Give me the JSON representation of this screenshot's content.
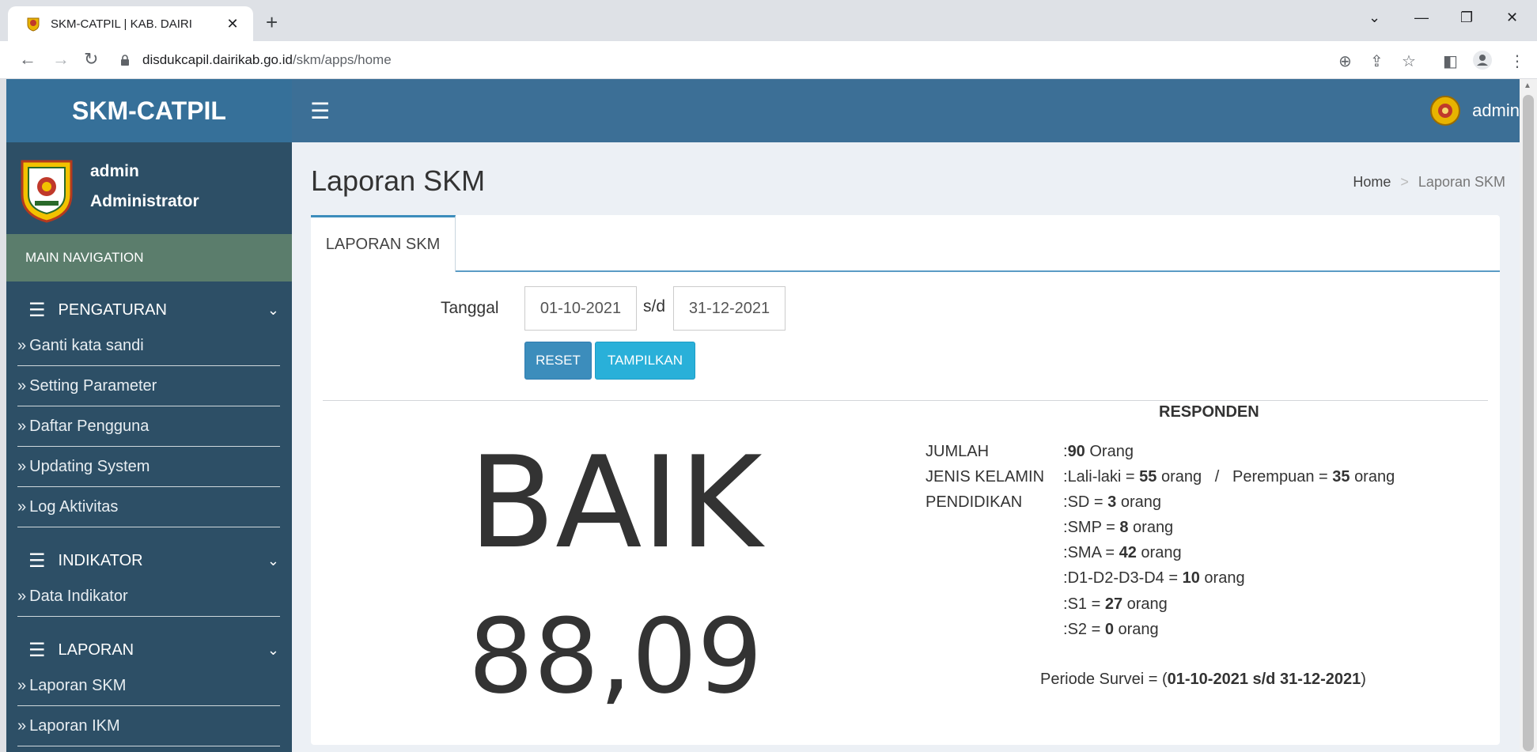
{
  "browser": {
    "tab_title": "SKM-CATPIL | KAB. DAIRI",
    "tab_close": "✕",
    "new_tab": "+",
    "url_host": "disdukcapil.dairikab.go.id",
    "url_path": "/skm/apps/home"
  },
  "header": {
    "brand": "SKM-CATPIL",
    "menu_icon": "☰",
    "user": "admin"
  },
  "sidebar": {
    "user_name": "admin",
    "user_role": "Administrator",
    "main_nav": "MAIN NAVIGATION",
    "sections": [
      {
        "title": "PENGATURAN",
        "items": [
          "Ganti kata sandi",
          "Setting Parameter",
          "Daftar Pengguna",
          "Updating System",
          "Log Aktivitas"
        ]
      },
      {
        "title": "INDIKATOR",
        "items": [
          "Data Indikator"
        ]
      },
      {
        "title": "LAPORAN",
        "items": [
          "Laporan SKM",
          "Laporan IKM"
        ]
      }
    ]
  },
  "page": {
    "title": "Laporan SKM",
    "breadcrumb_home": "Home",
    "breadcrumb_sep": ">",
    "breadcrumb_current": "Laporan SKM",
    "tab": "LAPORAN SKM"
  },
  "filter": {
    "label": "Tanggal",
    "from": "01-10-2021",
    "sd": "s/d",
    "to": "31-12-2021",
    "reset": "RESET",
    "show": "TAMPILKAN"
  },
  "result": {
    "rating": "BAIK",
    "score": "88,09"
  },
  "responden": {
    "title": "RESPONDEN",
    "jumlah_label": "JUMLAH",
    "jumlah_value": "90",
    "jumlah_unit": "Orang",
    "jk_label": "JENIS KELAMIN",
    "male_label": "Lali-laki =",
    "male_value": "55",
    "female_label": "Perempuan =",
    "female_value": "35",
    "pendidikan_label": "PENDIDIKAN",
    "unit": "orang",
    "pendidikan": [
      {
        "label": "SD =",
        "value": "3"
      },
      {
        "label": "SMP =",
        "value": "8"
      },
      {
        "label": "SMA =",
        "value": "42"
      },
      {
        "label": "D1-D2-D3-D4 =",
        "value": "10"
      },
      {
        "label": "S1 =",
        "value": "27"
      },
      {
        "label": "S2 =",
        "value": "0"
      }
    ],
    "periode_prefix": "Periode Survei = (",
    "periode_value": "01-10-2021 s/d 31-12-2021",
    "periode_suffix": ")"
  },
  "colors": {
    "topbar": "#3c6f96",
    "sidebar": "#2d4f66",
    "main_nav": "#5b7d6c",
    "btn_reset": "#3c8dbc",
    "btn_show": "#29b0d9"
  }
}
